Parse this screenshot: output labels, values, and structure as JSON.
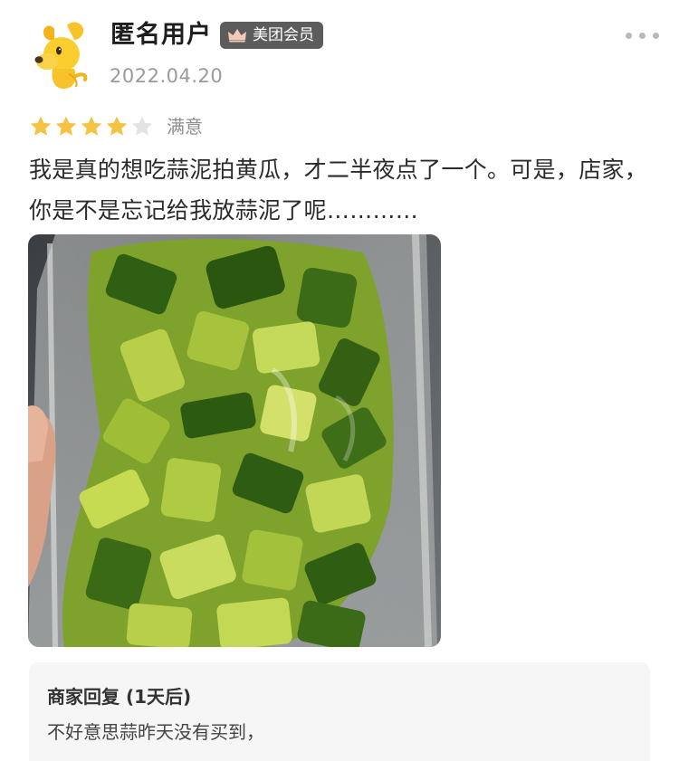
{
  "review": {
    "user": {
      "name": "匿名用户",
      "avatar": "yellow-dog-mascot-icon",
      "badge_label": "美团会员",
      "badge_icon": "crown-icon"
    },
    "date": "2022.04.20",
    "rating": {
      "stars": 4,
      "max_stars": 5,
      "label": "满意",
      "star_color": "#f5c242",
      "empty_star_color": "#e3e3e3"
    },
    "text": "我是真的想吃蒜泥拍黄瓜，才二半夜点了一个。可是，店家，你是不是忘记给我放蒜泥了呢…………",
    "photo": {
      "subject": "cucumber-salad-photo"
    },
    "more_icon": "more-dots-icon"
  },
  "merchant_reply": {
    "title": "商家回复 (1天后)",
    "text": "不好意思蒜昨天没有买到，"
  },
  "colors": {
    "badge_background": "#5c5c5c",
    "reply_background": "#f6f6f6",
    "date_gray": "#9a9a9a"
  }
}
